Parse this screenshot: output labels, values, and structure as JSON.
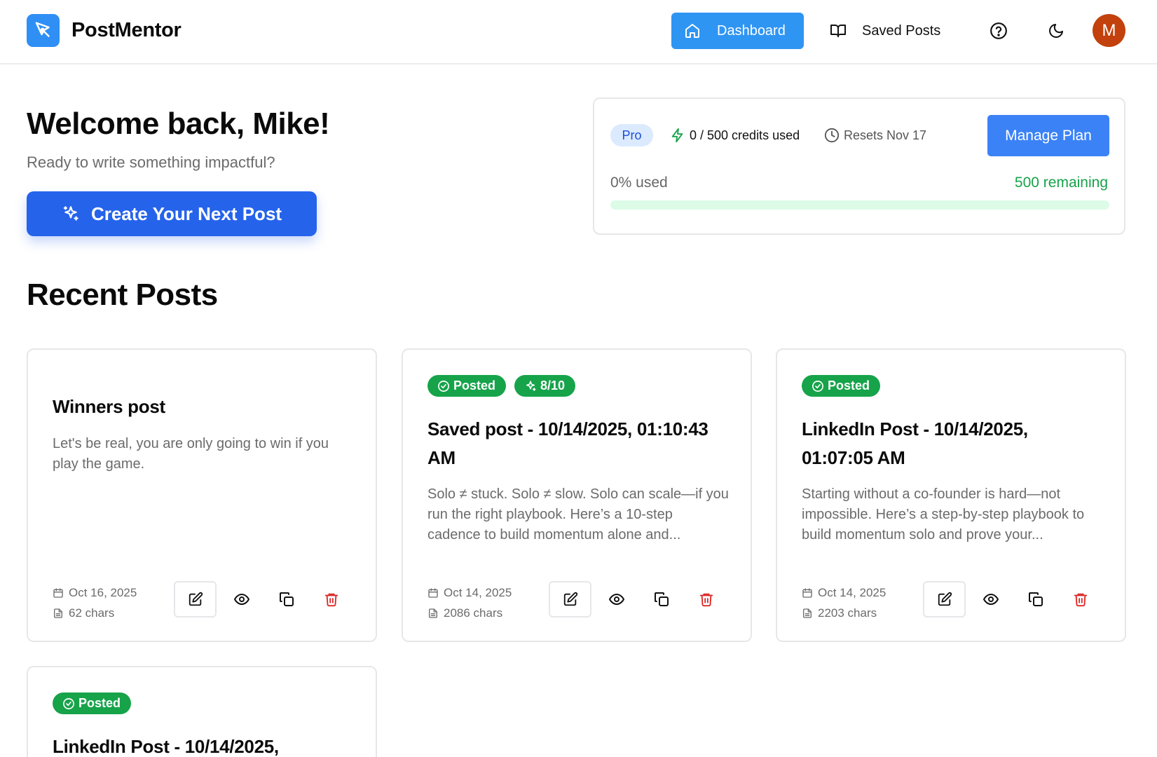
{
  "header": {
    "brand": "PostMentor",
    "nav_dashboard": "Dashboard",
    "nav_saved": "Saved Posts",
    "avatar_initial": "M"
  },
  "welcome": {
    "title": "Welcome back, Mike!",
    "subtitle": "Ready to write something impactful?",
    "create_button": "Create Your Next Post"
  },
  "credits": {
    "plan": "Pro",
    "used_text": "0 / 500 credits used",
    "resets_text": "Resets Nov 17",
    "manage_button": "Manage Plan",
    "used_label": "0% used",
    "remaining_label": "500 remaining",
    "used_fraction": 0
  },
  "recent": {
    "title": "Recent Posts",
    "posts": [
      {
        "title": "Winners post",
        "excerpt": "Let's be real, you are only going to win if you play the game.",
        "date": "Oct 16, 2025",
        "chars": "62 chars"
      },
      {
        "badge_posted": "Posted",
        "badge_score": "8/10",
        "title": "Saved post - 10/14/2025, 01:10:43 AM",
        "excerpt": "Solo ≠ stuck. Solo ≠ slow. Solo can scale—if you run the right playbook. Here’s a 10-step cadence to build momentum alone and...",
        "date": "Oct 14, 2025",
        "chars": "2086 chars"
      },
      {
        "badge_posted": "Posted",
        "title": "LinkedIn Post - 10/14/2025, 01:07:05 AM",
        "excerpt": "Starting without a co-founder is hard—not impossible. Here’s a step-by-step playbook to build momentum solo and prove your...",
        "date": "Oct 14, 2025",
        "chars": "2203 chars"
      },
      {
        "badge_posted": "Posted",
        "title": "LinkedIn Post - 10/14/2025,"
      }
    ]
  },
  "colors": {
    "accent": "#2563eb",
    "nav_active": "#2f95f3",
    "success": "#16a34a",
    "danger": "#dc2626",
    "avatar": "#c2410c"
  }
}
